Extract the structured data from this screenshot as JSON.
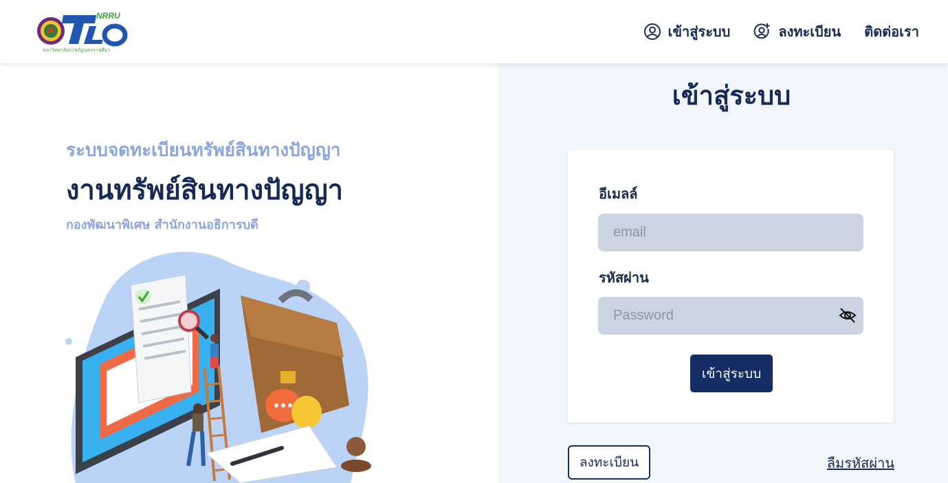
{
  "header": {
    "logo": {
      "text_main": "TLO",
      "text_badge": "NRRU",
      "text_caption": "มหาวิทยาลัยราชภัฏนครราชสีมา"
    },
    "nav": [
      {
        "label": "เข้าสู่ระบบ",
        "icon": "user-circle-icon"
      },
      {
        "label": "ลงทะเบียน",
        "icon": "user-plus-icon"
      },
      {
        "label": "ติดต่อเรา",
        "icon": ""
      }
    ]
  },
  "hero": {
    "subtitle": "ระบบจดทะเบียนทรัพย์สินทางปัญญา",
    "title": "งานทรัพย์สินทางปัญญา",
    "department": "กองพัฒนาพิเศษ สำนักงานอธิการบดี"
  },
  "login": {
    "heading": "เข้าสู่ระบบ",
    "email_label": "อีเมลล์",
    "email_placeholder": "email",
    "email_value": "",
    "password_label": "รหัสผ่าน",
    "password_placeholder": "Password",
    "password_value": "",
    "submit_label": "เข้าสู่ระบบ",
    "register_label": "ลงทะเบียน",
    "forgot_label": "ลืมรหัสผ่าน"
  },
  "colors": {
    "primary": "#142d65",
    "accent_light": "#8aa6e0",
    "panel_bg": "#f2f7fd",
    "input_bg": "#cbd5e1"
  }
}
